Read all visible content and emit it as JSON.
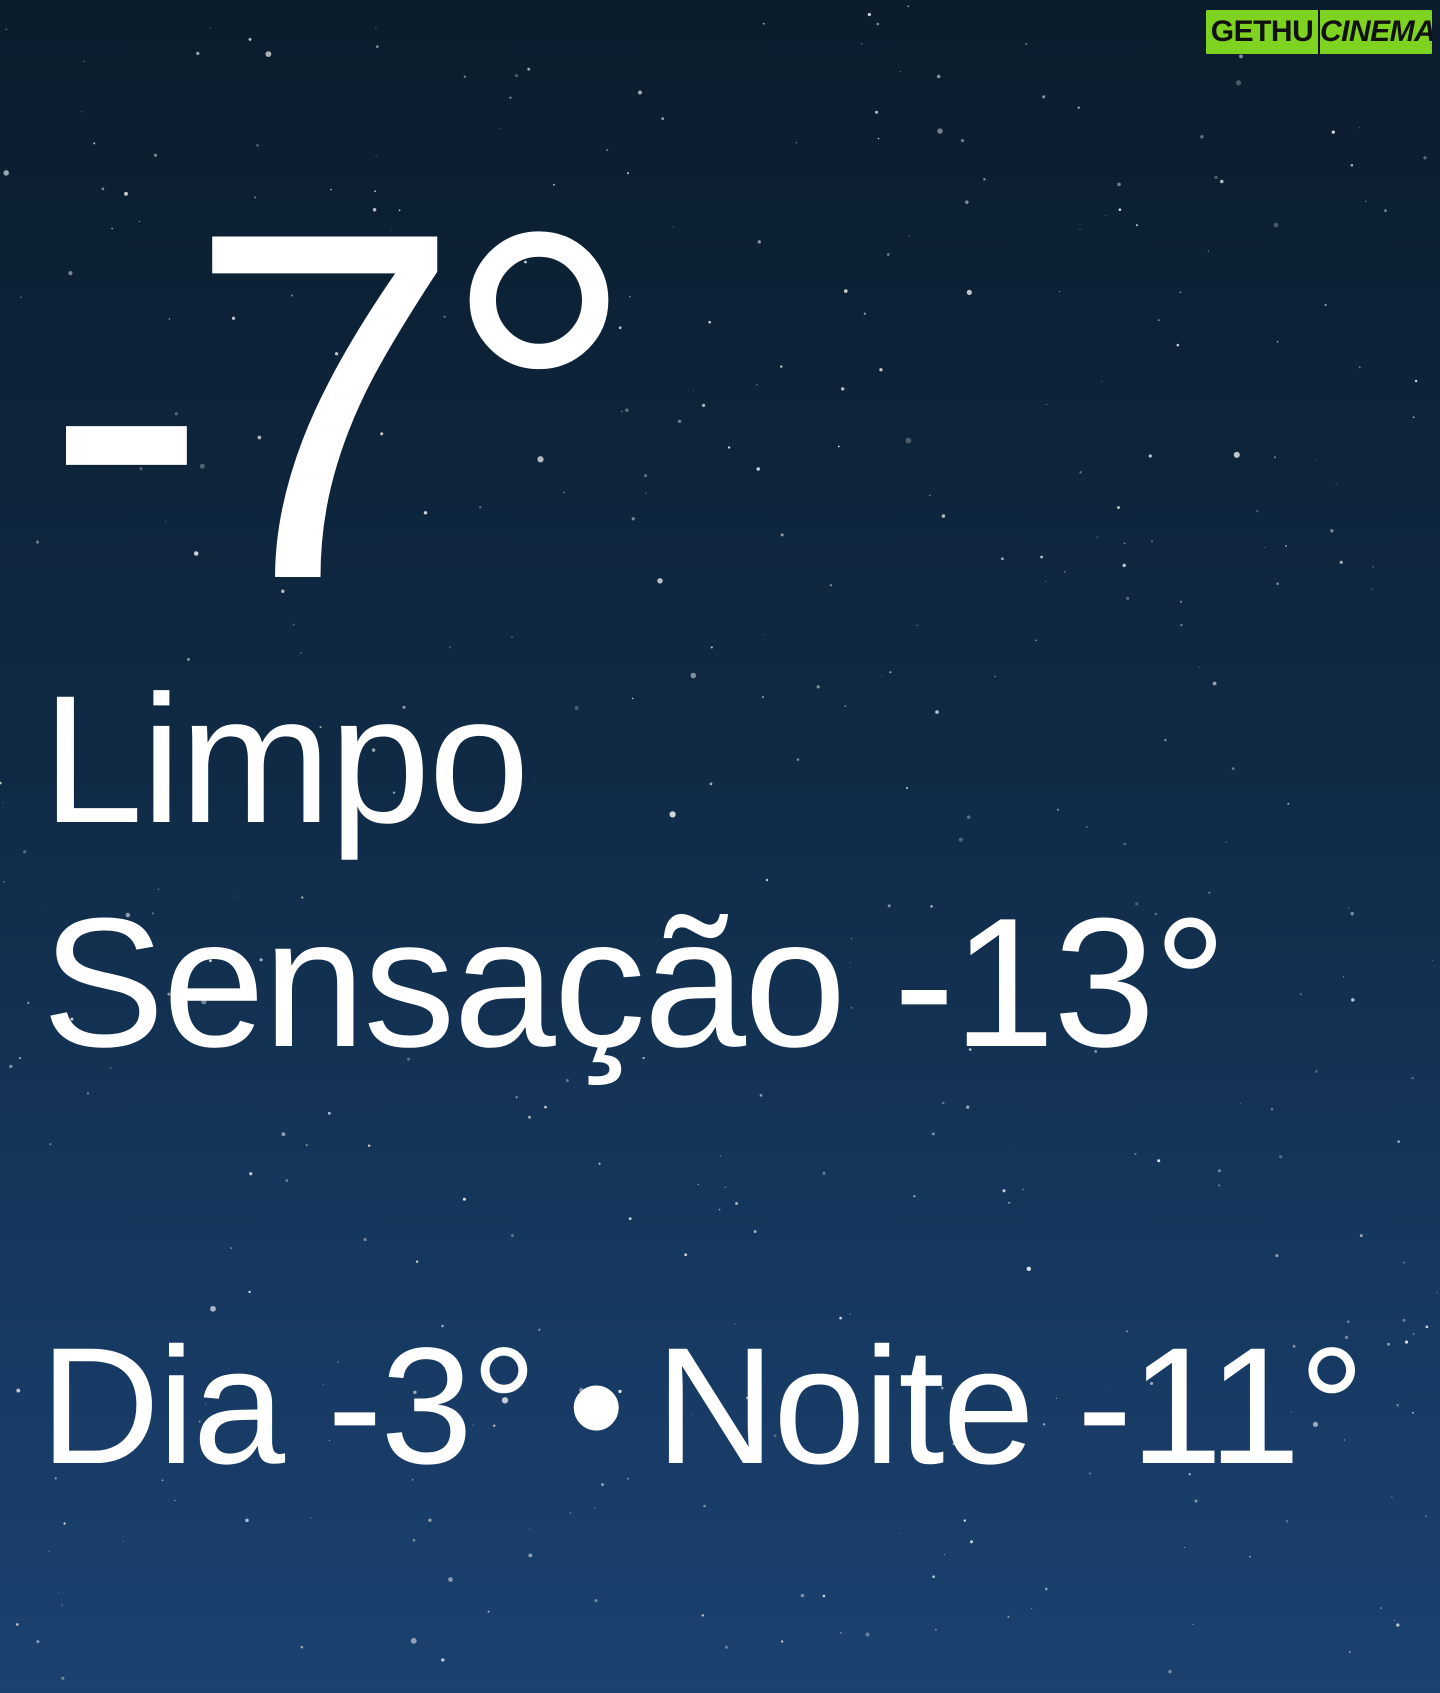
{
  "weather": {
    "temperature": "-7°",
    "condition": "Limpo",
    "feels_like": "Sensação -13°",
    "forecast": {
      "day": "Dia -3°",
      "separator": "•",
      "night": "Noite -11°"
    }
  },
  "watermark": {
    "left": "GETHU",
    "right": "CINEMA"
  },
  "colors": {
    "sky_top": "#0b1c2c",
    "sky_bottom": "#1a416f",
    "text": "#ffffff",
    "watermark_green": "#7ed321"
  }
}
